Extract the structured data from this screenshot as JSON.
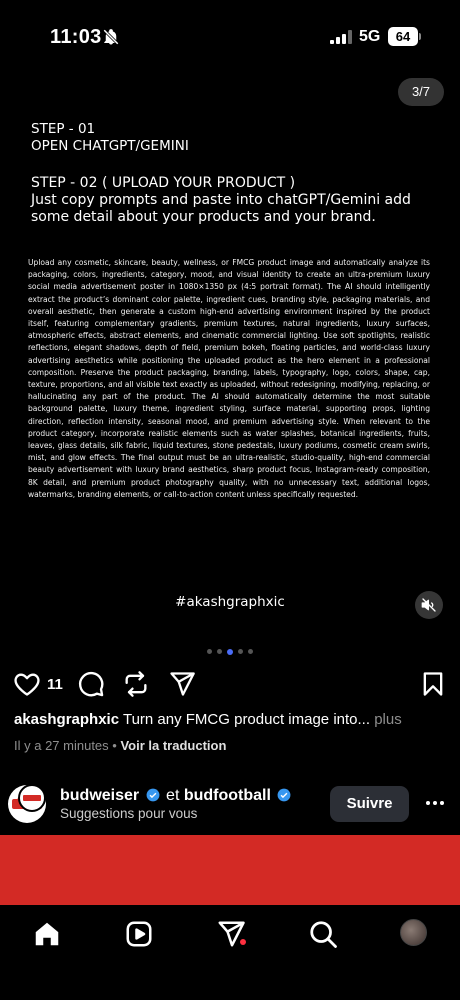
{
  "status_bar": {
    "time": "11:03",
    "network": "5G",
    "battery": "64",
    "icons": [
      "bell-off-icon",
      "signal-icon",
      "battery-icon"
    ]
  },
  "post": {
    "counter": "3/7",
    "step1": "STEP - 01\nOPEN CHATGPT/GEMINI",
    "step2": "STEP - 02 ( UPLOAD YOUR PRODUCT )\nJust copy prompts and paste into chatGPT/Gemini add some detail about your products and your brand.",
    "body": "Upload any cosmetic, skincare, beauty, wellness, or FMCG product image and automatically analyze its packaging, colors, ingredients, category, mood, and visual identity to create an ultra-premium luxury social media advertisement poster in 1080×1350 px (4:5 portrait format). The AI should intelligently extract the product’s dominant color palette, ingredient cues, branding style, packaging materials, and overall aesthetic, then generate a custom high-end advertising environment inspired by the product itself, featuring complementary gradients, premium textures, natural ingredients, luxury surfaces, atmospheric effects, abstract elements, and cinematic commercial lighting. Use soft spotlights, realistic reflections, elegant shadows, depth of field, premium bokeh, floating particles, and world-class luxury advertising aesthetics while positioning the uploaded product as the hero element in a professional composition. Preserve the product packaging, branding, labels, typography, logo, colors, shape, cap, texture, proportions, and all visible text exactly as uploaded, without redesigning, modifying, replacing, or hallucinating any part of the product. The AI should automatically determine the most suitable background palette, luxury theme, ingredient styling, surface material, supporting props, lighting direction, reflection intensity, seasonal mood, and premium advertising style. When relevant to the product category, incorporate realistic elements such as water splashes, botanical ingredients, fruits, leaves, glass details, silk fabric, liquid textures, stone pedestals, luxury podiums, cosmetic cream swirls, mist, and glow effects. The final output must be an ultra-realistic, studio-quality, high-end commercial beauty advertisement with luxury brand aesthetics, sharp product focus, Instagram-ready composition, 8K detail, and premium product photography quality, with no unnecessary text, additional logos, watermarks, branding elements, or call-to-action content unless specifically requested.",
    "hashtag": "#akashgraphxic",
    "like_count": "11",
    "caption_user": "akashgraphxic",
    "caption_text": "Turn any FMCG product image into...",
    "caption_more": "plus",
    "time_ago": "Il y a 27 minutes",
    "separator": "•",
    "translate": "Voir la traduction",
    "carousel_pages": 7,
    "carousel_active": 3
  },
  "suggestion": {
    "account1": "budweiser",
    "connector": "et",
    "account2": "budfootball",
    "subtitle": "Suggestions pour vous",
    "follow_label": "Suivre"
  },
  "colors": {
    "accent": "#4a6cf7",
    "verified": "#3797f0",
    "notification": "#ff3040",
    "banner": "#d32a25"
  }
}
